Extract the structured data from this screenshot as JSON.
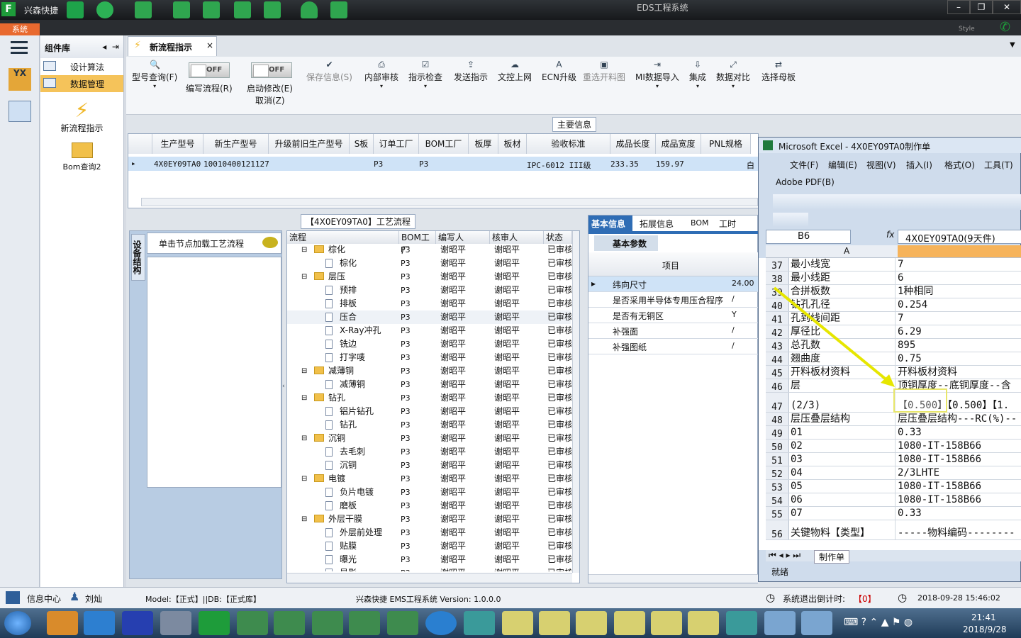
{
  "app": {
    "title": "兴森快捷",
    "window_title": "EDS工程系统",
    "style_label": "Style",
    "sys_tab": "系统"
  },
  "component_lib": {
    "title": "组件库",
    "items": [
      {
        "label": "设计算法"
      },
      {
        "label": "数据管理"
      }
    ],
    "big_items": [
      {
        "label": "新流程指示"
      },
      {
        "label": "Bom查询2"
      }
    ]
  },
  "tab": {
    "label": "新流程指示"
  },
  "toolbar": {
    "buttons": [
      {
        "label": "型号查询(F)"
      },
      {
        "label": "编写流程(R)",
        "toggle": "OFF"
      },
      {
        "label": "启动修改(E)",
        "sub": "取消(Z)",
        "toggle": "OFF"
      },
      {
        "label": "保存信息(S)",
        "disabled": true
      },
      {
        "label": "内部审核"
      },
      {
        "label": "指示检查"
      },
      {
        "label": "发送指示"
      },
      {
        "label": "文控上网"
      },
      {
        "label": "ECN升级"
      },
      {
        "label": "重选开料图",
        "disabled": true
      },
      {
        "label": "MI数据导入"
      },
      {
        "label": "集成"
      },
      {
        "label": "数据对比"
      },
      {
        "label": "选择母板"
      }
    ]
  },
  "main_info": {
    "title": "主要信息",
    "columns": [
      "生产型号",
      "新生产型号",
      "升级前旧生产型号",
      "S板",
      "订单工厂",
      "BOM工厂",
      "板厚",
      "板材",
      "验收标准",
      "成品长度",
      "成品宽度",
      "PNL规格"
    ],
    "row": [
      "4X0EY09TA0",
      "10010400121127",
      "",
      "",
      "P3",
      "P3",
      "",
      "",
      "IPC-6012 III级",
      "233.35",
      "159.97",
      "白"
    ]
  },
  "flow": {
    "title": "【4X0EY09TA0】工艺流程",
    "side_label": "设备结构",
    "hint": "单击节点加载工艺流程",
    "columns": [
      "流程",
      "BOM工厂",
      "编写人",
      "核审人",
      "状态"
    ],
    "rows": [
      {
        "name": "棕化",
        "level": 0
      },
      {
        "name": "棕化",
        "level": 1
      },
      {
        "name": "层压",
        "level": 0
      },
      {
        "name": "预排",
        "level": 1
      },
      {
        "name": "排板",
        "level": 1
      },
      {
        "name": "压合",
        "level": 1
      },
      {
        "name": "X-Ray冲孔",
        "level": 1
      },
      {
        "name": "铣边",
        "level": 1
      },
      {
        "name": "打字唛",
        "level": 1
      },
      {
        "name": "减薄铜",
        "level": 0
      },
      {
        "name": "减薄铜",
        "level": 1
      },
      {
        "name": "钻孔",
        "level": 0
      },
      {
        "name": "铝片钻孔",
        "level": 1
      },
      {
        "name": "钻孔",
        "level": 1
      },
      {
        "name": "沉铜",
        "level": 0
      },
      {
        "name": "去毛刺",
        "level": 1
      },
      {
        "name": "沉铜",
        "level": 1
      },
      {
        "name": "电镀",
        "level": 0
      },
      {
        "name": "负片电镀",
        "level": 1
      },
      {
        "name": "磨板",
        "level": 1
      },
      {
        "name": "外层干膜",
        "level": 0
      },
      {
        "name": "外层前处理",
        "level": 1
      },
      {
        "name": "贴膜",
        "level": 1
      },
      {
        "name": "曝光",
        "level": 1
      },
      {
        "name": "显影",
        "level": 1
      }
    ],
    "cell": {
      "factory": "P3",
      "writer": "谢昭平",
      "reviewer": "谢昭平",
      "status": "已审核"
    }
  },
  "basic": {
    "tabs": [
      "基本信息",
      "拓展信息",
      "BOM",
      "工时"
    ],
    "subtab": "基本参数",
    "col": "项目",
    "rows": [
      {
        "k": "纬向尺寸",
        "v": "24.00"
      },
      {
        "k": "是否采用半导体专用压合程序",
        "v": "/"
      },
      {
        "k": "是否有无铜区",
        "v": "Y"
      },
      {
        "k": "补强面",
        "v": "/"
      },
      {
        "k": "补强图纸",
        "v": "/"
      }
    ]
  },
  "excel": {
    "title": "Microsoft Excel - 4X0EY09TA0制作单",
    "menu": [
      "文件(F)",
      "编辑(E)",
      "视图(V)",
      "插入(I)",
      "格式(O)",
      "工具(T)"
    ],
    "adobe": "Adobe PDF(B)",
    "namebox": "B6",
    "formula": "4X0EY09TA0(9天件)",
    "col_a": "A",
    "sheet": "制作单",
    "status": "就绪",
    "rows": [
      {
        "n": "37",
        "a": "最小线宽",
        "b": "7"
      },
      {
        "n": "38",
        "a": "最小线距",
        "b": "6"
      },
      {
        "n": "39",
        "a": "合拼板数",
        "b": "1种相同"
      },
      {
        "n": "40",
        "a": "钻孔孔径",
        "b": "0.254"
      },
      {
        "n": "41",
        "a": "孔到线间距",
        "b": "7"
      },
      {
        "n": "42",
        "a": "厚径比",
        "b": "6.29"
      },
      {
        "n": "43",
        "a": "总孔数",
        "b": "895"
      },
      {
        "n": "44",
        "a": "翘曲度",
        "b": "0.75"
      },
      {
        "n": "45",
        "a": "开料板材资料",
        "b": "开料板材资料"
      },
      {
        "n": "46",
        "a": "层",
        "b": "顶铜厚度--底铜厚度--含"
      },
      {
        "n": "47",
        "a": "(2/3)",
        "b": "【0.500】【0.500】【1."
      },
      {
        "n": "48",
        "a": "层压叠层结构",
        "b": "层压叠层结构---RC(%)--"
      },
      {
        "n": "49",
        "a": "01",
        "b": "0.33"
      },
      {
        "n": "50",
        "a": "02",
        "b": "1080-IT-158B66"
      },
      {
        "n": "51",
        "a": "03",
        "b": "1080-IT-158B66"
      },
      {
        "n": "52",
        "a": "04",
        "b": "2/3LHTE"
      },
      {
        "n": "53",
        "a": "05",
        "b": "1080-IT-158B66"
      },
      {
        "n": "54",
        "a": "06",
        "b": "1080-IT-158B66"
      },
      {
        "n": "55",
        "a": "07",
        "b": "0.33"
      },
      {
        "n": "56",
        "a": "关键物料【类型】",
        "b": "-----物料编码--------"
      }
    ]
  },
  "statusbar": {
    "info_center": "信息中心",
    "user": "刘灿",
    "model": "Model:【正式】||DB:【正式库】",
    "version": "兴森快捷 EMS工程系统 Version: 1.0.0.0",
    "countdown_label": "系统退出倒计时:",
    "countdown": "【0】",
    "datetime": "2018-09-28 15:46:02"
  },
  "taskbar": {
    "time": "21:41",
    "date": "2018/9/28"
  }
}
